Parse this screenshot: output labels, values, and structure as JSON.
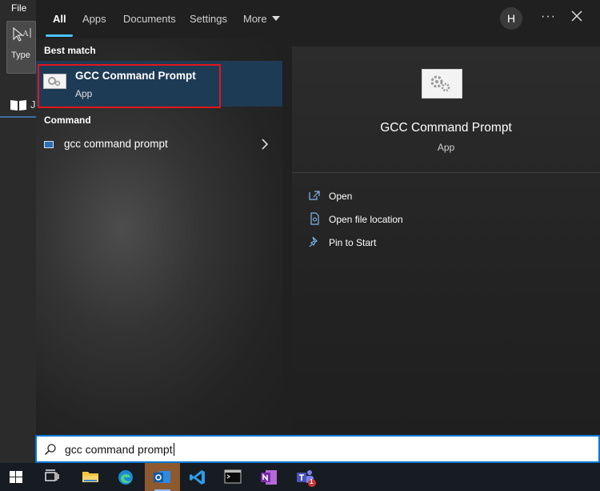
{
  "background_app": {
    "menu_file": "File",
    "tool_type_label": "Type",
    "sidebar_letter": "J"
  },
  "tabs": [
    {
      "label": "All",
      "active": true
    },
    {
      "label": "Apps",
      "active": false
    },
    {
      "label": "Documents",
      "active": false
    },
    {
      "label": "Settings",
      "active": false
    },
    {
      "label": "More",
      "active": false
    }
  ],
  "header": {
    "avatar_initial": "H",
    "more_options": "···"
  },
  "results": {
    "best_match_heading": "Best match",
    "best_match": {
      "title": "GCC Command Prompt",
      "subtitle": "App",
      "icon": "gear-app-icon"
    },
    "command_heading": "Command",
    "command_item": {
      "label": "gcc command prompt",
      "icon": "console-icon"
    }
  },
  "preview": {
    "title": "GCC Command Prompt",
    "subtitle": "App",
    "actions": [
      {
        "label": "Open",
        "icon": "open-icon"
      },
      {
        "label": "Open file location",
        "icon": "file-location-icon"
      },
      {
        "label": "Pin to Start",
        "icon": "pin-icon"
      }
    ]
  },
  "search": {
    "value": "gcc command prompt"
  },
  "taskbar": {
    "items": [
      {
        "name": "start",
        "icon": "windows-logo-icon"
      },
      {
        "name": "task-view",
        "icon": "task-view-icon"
      },
      {
        "name": "file-explorer",
        "icon": "folder-icon"
      },
      {
        "name": "edge",
        "icon": "edge-icon"
      },
      {
        "name": "outlook",
        "icon": "outlook-icon",
        "active": true
      },
      {
        "name": "vscode",
        "icon": "vscode-icon"
      },
      {
        "name": "terminal",
        "icon": "terminal-icon"
      },
      {
        "name": "onenote",
        "icon": "onenote-icon"
      },
      {
        "name": "teams",
        "icon": "teams-icon",
        "badge": "1"
      }
    ]
  },
  "colors": {
    "accent": "#4cc2ff",
    "selection_bg": "#1e3b56",
    "highlight_border": "#e3151d",
    "search_border": "#0078d4"
  }
}
